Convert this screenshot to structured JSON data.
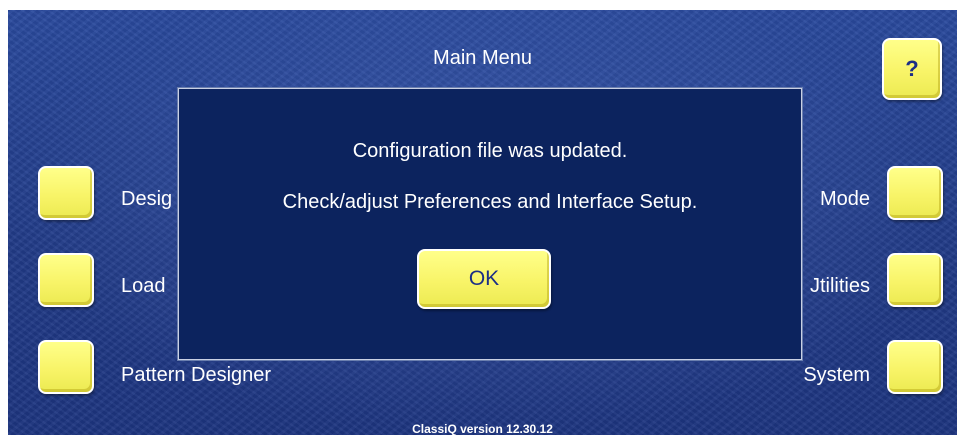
{
  "main_menu": {
    "title": "Main Menu",
    "help_label": "?",
    "left_items": [
      {
        "label": "Desig"
      },
      {
        "label": "Load"
      },
      {
        "label": "Pattern Designer"
      }
    ],
    "right_items": [
      {
        "label": "Mode"
      },
      {
        "label": "Jtilities"
      },
      {
        "label": "System"
      }
    ],
    "version": "ClassiQ version 12.30.12"
  },
  "dialog": {
    "line1": "Configuration file was updated.",
    "line2": "Check/adjust Preferences and Interface Setup.",
    "ok_label": "OK"
  },
  "colors": {
    "background": "#243f8d",
    "dialog_background": "#0c235e",
    "button_yellow": "#f8f468",
    "button_text": "#1c2f86"
  }
}
